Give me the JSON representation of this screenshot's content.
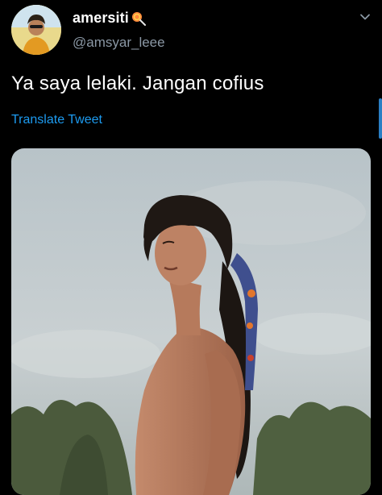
{
  "tweet": {
    "display_name": "amersiti",
    "handle": "@amsyar_leee",
    "text": "Ya saya lelaki. Jangan cofius",
    "translate_label": "Translate Tweet"
  },
  "icons": {
    "name_emoji": "lollipop-emoji-icon",
    "menu": "chevron-down-icon"
  },
  "colors": {
    "background": "#000000",
    "link": "#1d9bf0",
    "secondary_text": "#8b98a5"
  }
}
